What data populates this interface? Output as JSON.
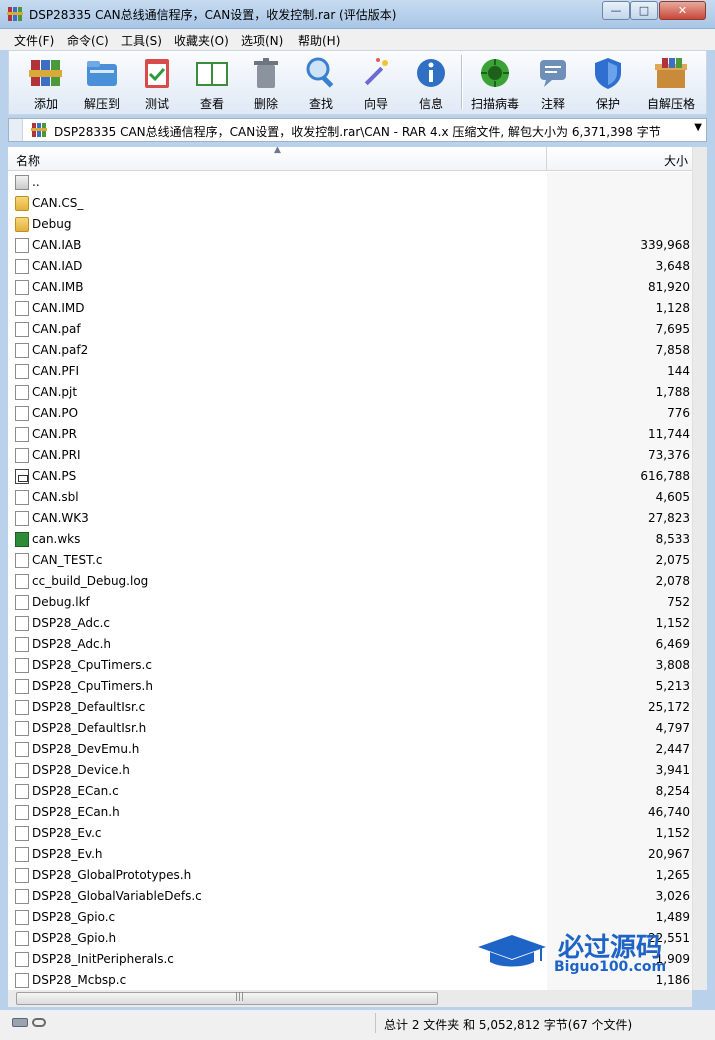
{
  "window": {
    "title": "DSP28335 CAN总线通信程序，CAN设置，收发控制.rar (评估版本)",
    "minimize": "—",
    "maximize": "□",
    "close": "✕"
  },
  "menu": [
    "文件(F)",
    "命令(C)",
    "工具(S)",
    "收藏夹(O)",
    "选项(N)",
    "帮助(H)"
  ],
  "toolbar": [
    {
      "label": "添加",
      "icon": "add-archive-icon",
      "color": "#c0392b"
    },
    {
      "label": "解压到",
      "icon": "extract-to-icon",
      "color": "#4a90d9"
    },
    {
      "label": "测试",
      "icon": "test-icon",
      "color": "#d94b4b"
    },
    {
      "label": "查看",
      "icon": "view-book-icon",
      "color": "#3b8c3b"
    },
    {
      "label": "删除",
      "icon": "delete-trash-icon",
      "color": "#8a939e"
    },
    {
      "label": "查找",
      "icon": "find-magnifier-icon",
      "color": "#3a7fd0"
    },
    {
      "label": "向导",
      "icon": "wizard-wand-icon",
      "color": "#6b6bd0"
    },
    {
      "label": "信息",
      "icon": "info-icon",
      "color": "#2f6fc4"
    },
    {
      "label": "扫描病毒",
      "icon": "scan-virus-icon",
      "color": "#3aa336"
    },
    {
      "label": "注释",
      "icon": "comment-icon",
      "color": "#6d8fb8"
    },
    {
      "label": "保护",
      "icon": "protect-shield-icon",
      "color": "#2e6fd0"
    },
    {
      "label": "自解压格",
      "icon": "sfx-box-icon",
      "color": "#c98a3a"
    }
  ],
  "path": {
    "text": "DSP28335 CAN总线通信程序，CAN设置，收发控制.rar\\CAN - RAR 4.x 压缩文件, 解包大小为 6,371,398 字节",
    "dropdown": "▼"
  },
  "columns": {
    "name": "名称",
    "size": "大小",
    "sort": "▲"
  },
  "files": [
    {
      "name": "..",
      "size": "",
      "type": "up"
    },
    {
      "name": "CAN.CS_",
      "size": "",
      "type": "folder"
    },
    {
      "name": "Debug",
      "size": "",
      "type": "folder"
    },
    {
      "name": "CAN.IAB",
      "size": "339,968",
      "type": "file"
    },
    {
      "name": "CAN.IAD",
      "size": "3,648",
      "type": "file"
    },
    {
      "name": "CAN.IMB",
      "size": "81,920",
      "type": "file"
    },
    {
      "name": "CAN.IMD",
      "size": "1,128",
      "type": "file"
    },
    {
      "name": "CAN.paf",
      "size": "7,695",
      "type": "file"
    },
    {
      "name": "CAN.paf2",
      "size": "7,858",
      "type": "file"
    },
    {
      "name": "CAN.PFI",
      "size": "144",
      "type": "file"
    },
    {
      "name": "CAN.pjt",
      "size": "1,788",
      "type": "file"
    },
    {
      "name": "CAN.PO",
      "size": "776",
      "type": "file"
    },
    {
      "name": "CAN.PR",
      "size": "11,744",
      "type": "file"
    },
    {
      "name": "CAN.PRI",
      "size": "73,376",
      "type": "file"
    },
    {
      "name": "CAN.PS",
      "size": "616,788",
      "type": "ps"
    },
    {
      "name": "CAN.sbl",
      "size": "4,605",
      "type": "file"
    },
    {
      "name": "CAN.WK3",
      "size": "27,823",
      "type": "file"
    },
    {
      "name": "can.wks",
      "size": "8,533",
      "type": "wks"
    },
    {
      "name": "CAN_TEST.c",
      "size": "2,075",
      "type": "file"
    },
    {
      "name": "cc_build_Debug.log",
      "size": "2,078",
      "type": "file"
    },
    {
      "name": "Debug.lkf",
      "size": "752",
      "type": "file"
    },
    {
      "name": "DSP28_Adc.c",
      "size": "1,152",
      "type": "file"
    },
    {
      "name": "DSP28_Adc.h",
      "size": "6,469",
      "type": "file"
    },
    {
      "name": "DSP28_CpuTimers.c",
      "size": "3,808",
      "type": "file"
    },
    {
      "name": "DSP28_CpuTimers.h",
      "size": "5,213",
      "type": "file"
    },
    {
      "name": "DSP28_DefaultIsr.c",
      "size": "25,172",
      "type": "file"
    },
    {
      "name": "DSP28_DefaultIsr.h",
      "size": "4,797",
      "type": "file"
    },
    {
      "name": "DSP28_DevEmu.h",
      "size": "2,447",
      "type": "file"
    },
    {
      "name": "DSP28_Device.h",
      "size": "3,941",
      "type": "file"
    },
    {
      "name": "DSP28_ECan.c",
      "size": "8,254",
      "type": "file"
    },
    {
      "name": "DSP28_ECan.h",
      "size": "46,740",
      "type": "file"
    },
    {
      "name": "DSP28_Ev.c",
      "size": "1,152",
      "type": "file"
    },
    {
      "name": "DSP28_Ev.h",
      "size": "20,967",
      "type": "file"
    },
    {
      "name": "DSP28_GlobalPrototypes.h",
      "size": "1,265",
      "type": "file"
    },
    {
      "name": "DSP28_GlobalVariableDefs.c",
      "size": "3,026",
      "type": "file"
    },
    {
      "name": "DSP28_Gpio.c",
      "size": "1,489",
      "type": "file"
    },
    {
      "name": "DSP28_Gpio.h",
      "size": "22,551",
      "type": "file"
    },
    {
      "name": "DSP28_InitPeripherals.c",
      "size": "1,909",
      "type": "file"
    },
    {
      "name": "DSP28_Mcbsp.c",
      "size": "1,186",
      "type": "file"
    }
  ],
  "hscroll_grip": "|||",
  "status": {
    "text": "总计 2 文件夹 和 5,052,812 字节(67 个文件)"
  },
  "watermark": {
    "title": "必过源码",
    "subtitle": "Biguo100.com"
  }
}
